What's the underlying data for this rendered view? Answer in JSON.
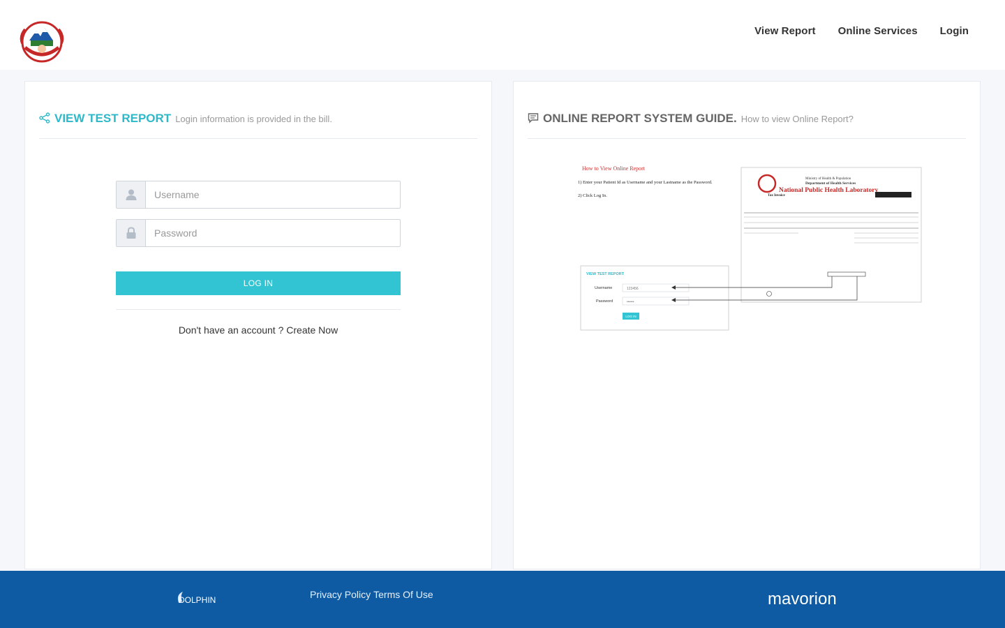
{
  "nav": {
    "items": [
      {
        "label": "View Report"
      },
      {
        "label": "Online Services"
      },
      {
        "label": "Login"
      }
    ]
  },
  "left_panel": {
    "title": "VIEW TEST REPORT",
    "subtitle": "Login information is provided in the bill.",
    "username_placeholder": "Username",
    "password_placeholder": "Password",
    "login_label": "LOG IN",
    "signup_text": "Don't have an account ? Create Now"
  },
  "right_panel": {
    "title": "ONLINE REPORT SYSTEM GUIDE.",
    "subtitle": "How to view Online Report?",
    "guide": {
      "heading": "How to View Online Report",
      "step1": "1) Enter your Patient Id as Username and your Lastname as the Password.",
      "step2": "2) Click Log In.",
      "bill_title": "National Public Health Laboratory",
      "bill_ministry": "Ministry of Health & Population",
      "bill_department": "Department of Health Services",
      "bill_invoice": "Tax Invoice",
      "mini_title": "VIEW TEST REPORT",
      "mini_username_label": "Username",
      "mini_password_label": "Password",
      "mini_username_value": "123456",
      "mini_password_value": "••••••",
      "mini_login": "LOG IN"
    }
  },
  "footer": {
    "privacy": "Privacy Policy",
    "terms": "Terms Of Use",
    "brand_left": "DOLPHIN",
    "brand_right": "mavorion"
  },
  "colors": {
    "accent": "#33c4d3",
    "title_teal": "#2fb8c8",
    "footer_bg": "#0e5ba4"
  }
}
